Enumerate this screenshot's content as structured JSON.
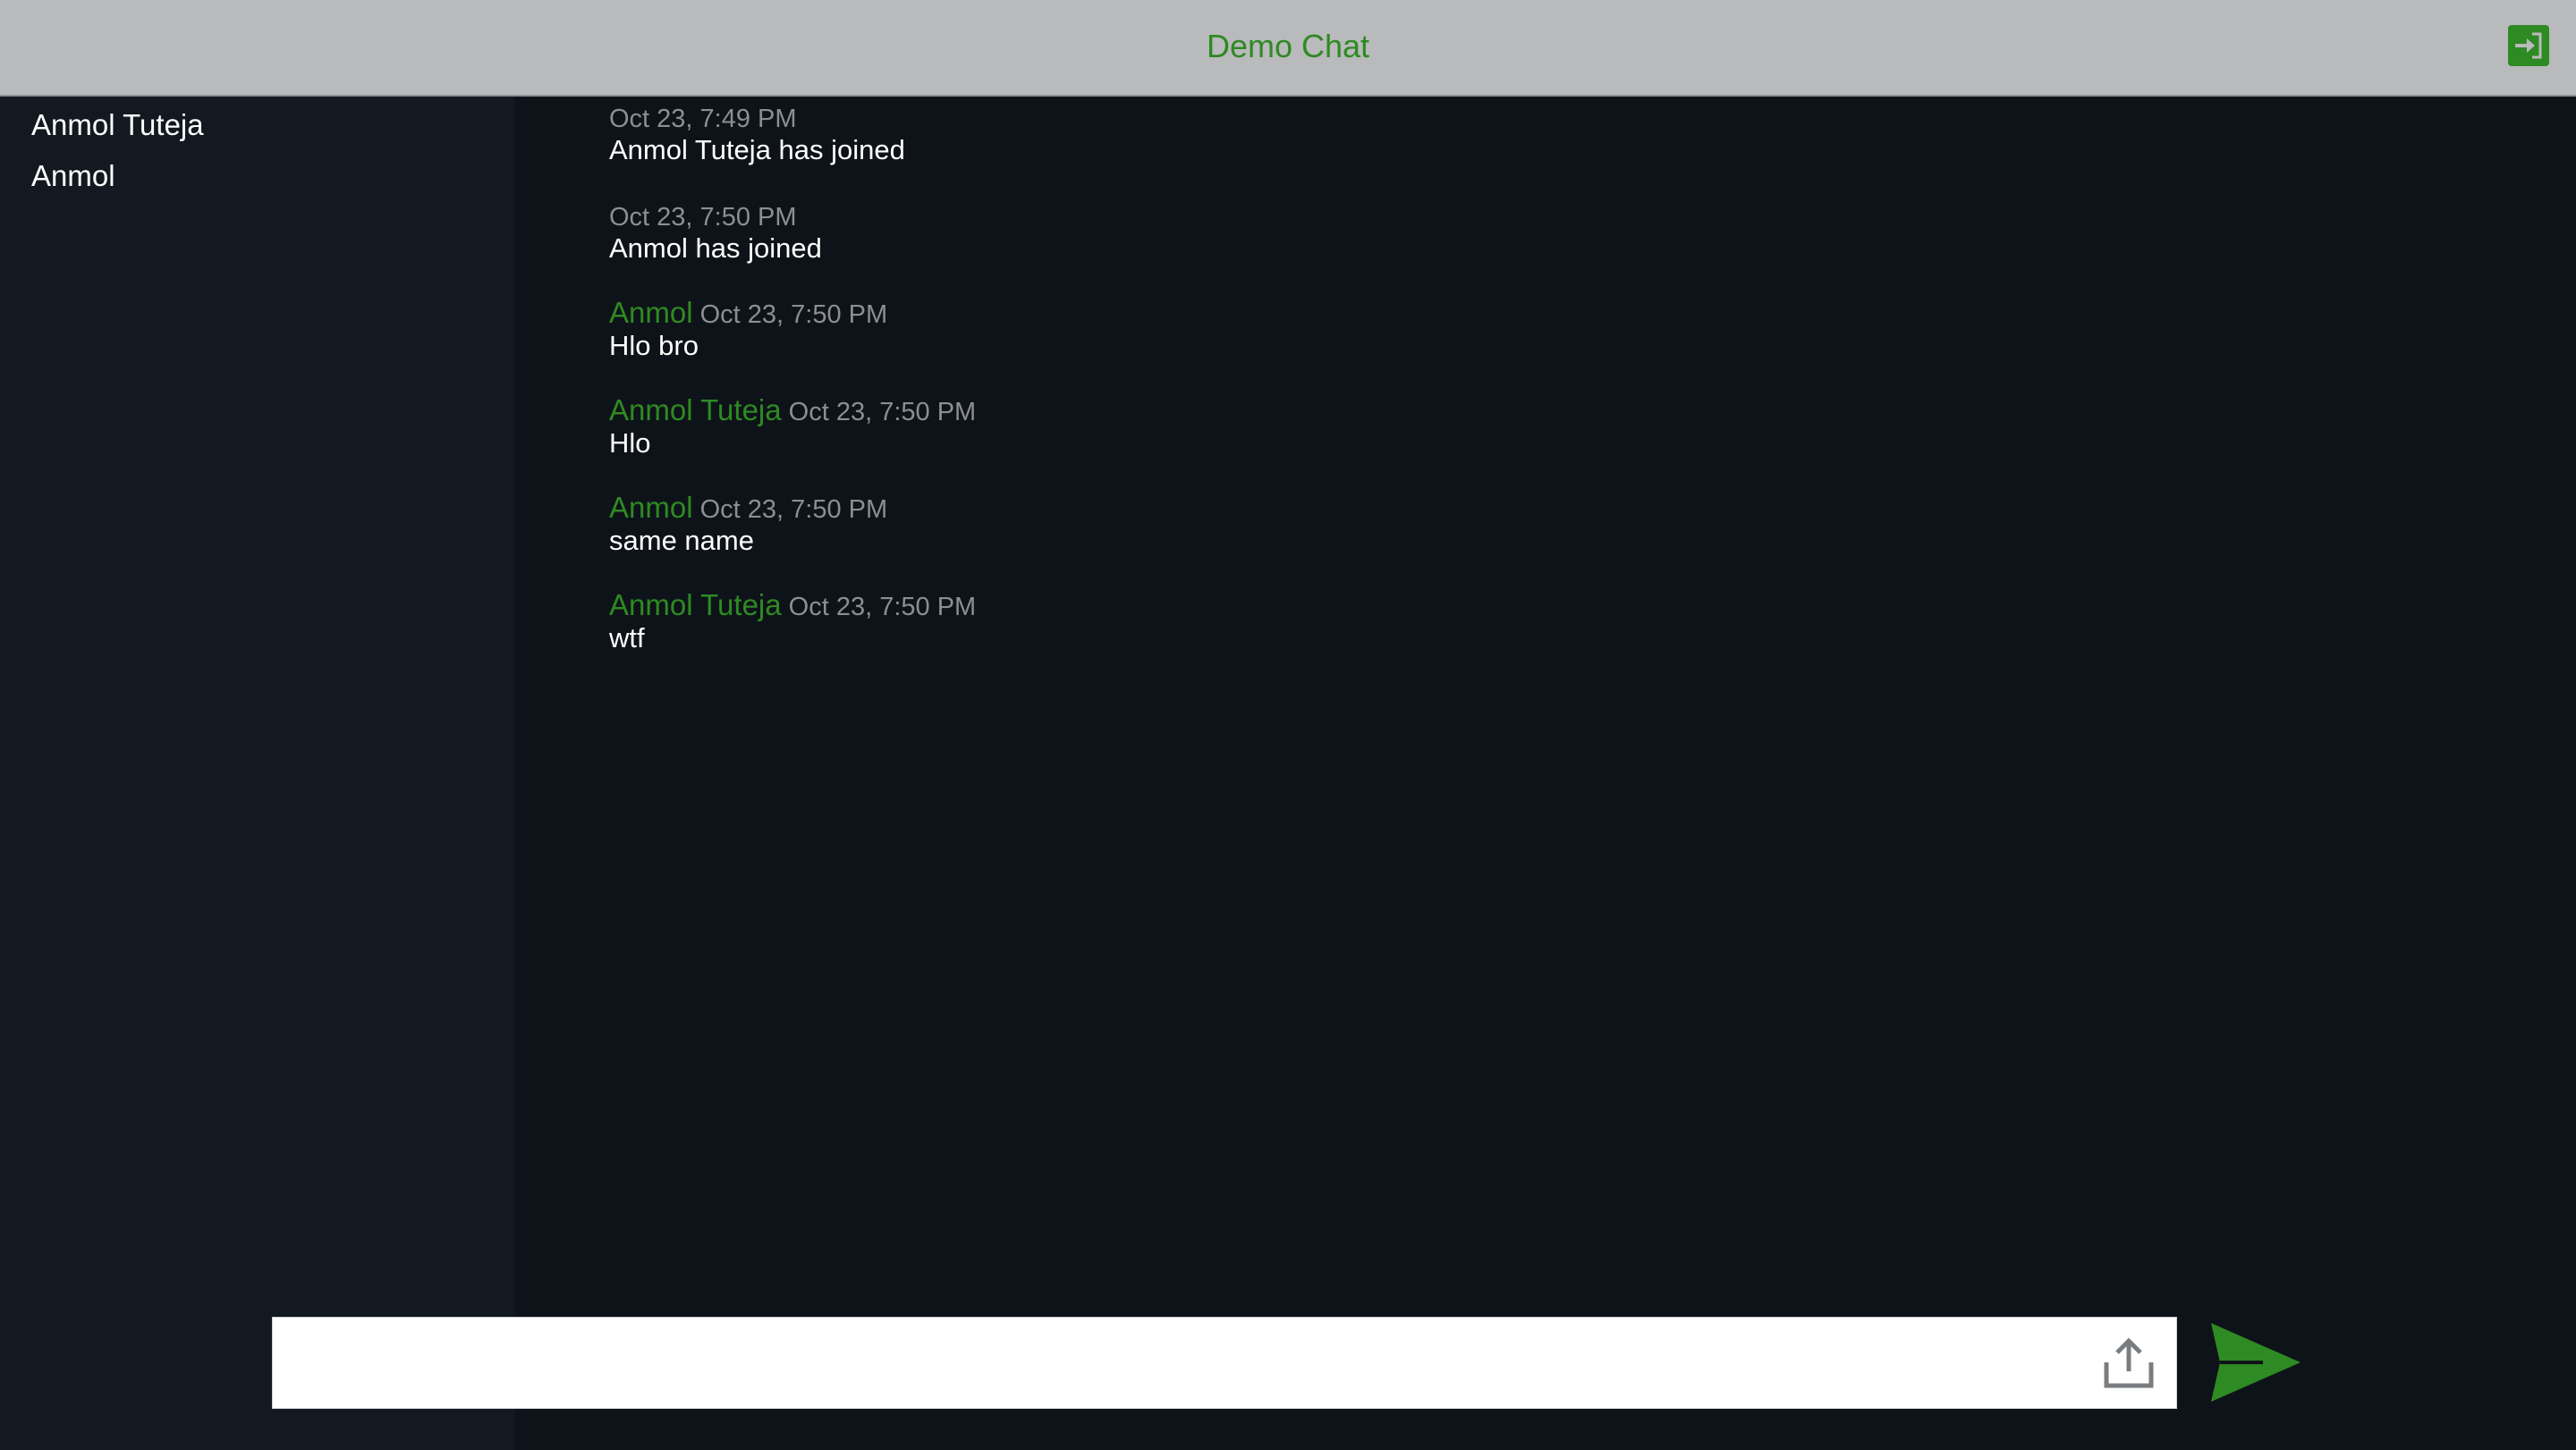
{
  "header": {
    "title": "Demo Chat",
    "exit_icon": "exit-to-app-icon"
  },
  "sidebar": {
    "users": [
      {
        "name": "Anmol Tuteja"
      },
      {
        "name": "Anmol"
      }
    ]
  },
  "messages": [
    {
      "author": "",
      "time": "Oct 23, 7:49 PM",
      "text": "Anmol Tuteja has joined"
    },
    {
      "author": "",
      "time": "Oct 23, 7:50 PM",
      "text": "Anmol has joined"
    },
    {
      "author": "Anmol",
      "time": "Oct 23, 7:50 PM",
      "text": "Hlo bro"
    },
    {
      "author": "Anmol Tuteja",
      "time": "Oct 23, 7:50 PM",
      "text": "Hlo"
    },
    {
      "author": "Anmol",
      "time": "Oct 23, 7:50 PM",
      "text": "same name"
    },
    {
      "author": "Anmol Tuteja",
      "time": "Oct 23, 7:50 PM",
      "text": "wtf"
    }
  ],
  "composer": {
    "value": "",
    "placeholder": "",
    "upload_icon": "upload-icon",
    "send_icon": "send-icon"
  },
  "colors": {
    "accent": "#2e8a22",
    "header_bg": "#b9babc",
    "sidebar_bg": "#121920",
    "main_bg": "#0e1319",
    "timestamp": "#8b8e92"
  }
}
